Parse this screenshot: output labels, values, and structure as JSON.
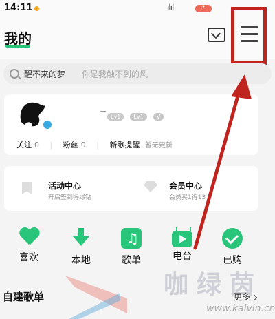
{
  "status": {
    "time": "14:11",
    "signal": "ılıl"
  },
  "header": {
    "title": "我的"
  },
  "search": {
    "query": "醒不来的梦",
    "hint": "你是我触不到的风"
  },
  "profile": {
    "username": "_",
    "badges": [
      "Lv1",
      "Lv1",
      ""
    ],
    "follow_label": "关注",
    "follow_count": "0",
    "fans_label": "粉丝",
    "fans_count": "0",
    "new_song_label": "新歌提醒",
    "new_song_status": "暂无更新"
  },
  "activity": {
    "left_title": "活动中心",
    "left_sub": "开启签到得绿钻",
    "right_title": "会员中心",
    "right_sub": "会员买1得13"
  },
  "quick": [
    {
      "label": "喜欢",
      "icon": "heart-icon"
    },
    {
      "label": "本地",
      "icon": "download-icon"
    },
    {
      "label": "歌单",
      "icon": "music-note-icon"
    },
    {
      "label": "电台",
      "icon": "radio-tv-icon"
    },
    {
      "label": "已购",
      "icon": "check-icon"
    }
  ],
  "section": {
    "title": "自建歌单",
    "more": "更多"
  },
  "watermark": {
    "text": "咖绿茵",
    "url": "www.kalvin.cn"
  },
  "colors": {
    "accent": "#29c57a",
    "highlight": "#c0241e"
  }
}
